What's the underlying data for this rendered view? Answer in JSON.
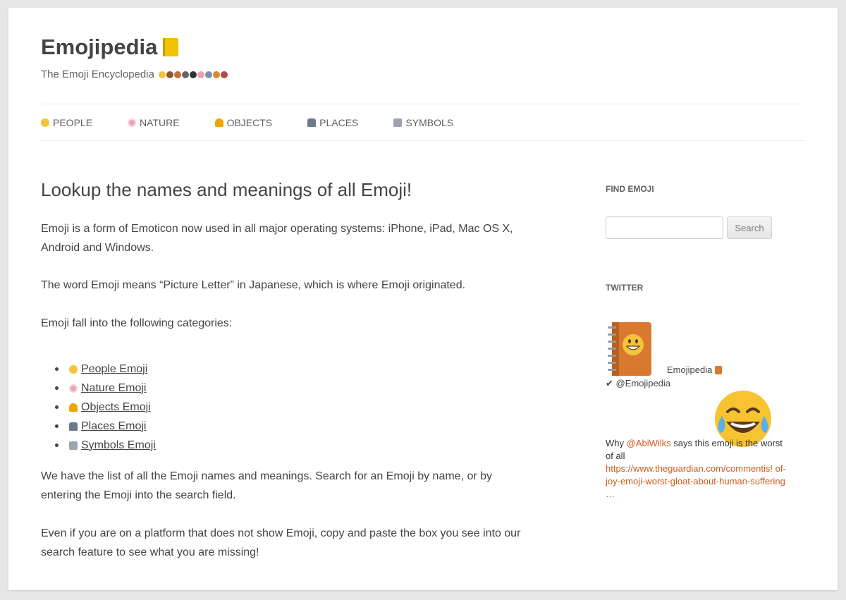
{
  "site": {
    "title": "Emojipedia",
    "title_icon": "notebook-icon",
    "tagline": "The Emoji Encyclopedia"
  },
  "nav": {
    "items": [
      {
        "label": "PEOPLE",
        "icon": "smiley-icon"
      },
      {
        "label": "NATURE",
        "icon": "flower-icon"
      },
      {
        "label": "OBJECTS",
        "icon": "bell-icon"
      },
      {
        "label": "PLACES",
        "icon": "car-icon"
      },
      {
        "label": "SYMBOLS",
        "icon": "symbols-icon"
      }
    ]
  },
  "main": {
    "heading": "Lookup the names and meanings of all Emoji!",
    "paragraphs": [
      "Emoji is a form of Emoticon now used in all major operating systems: iPhone, iPad, Mac OS X, Android and Windows.",
      "The word Emoji means “Picture Letter” in Japanese, which is where Emoji originated.",
      "Emoji fall into the following categories:",
      "We have the list of all the Emoji names and meanings. Search for an Emoji by name, or by entering the Emoji into the search field.",
      "Even if you are on a platform that does not show Emoji, copy and paste the box you see into our search feature to see what you are missing!"
    ],
    "categories": [
      {
        "label": "People Emoji",
        "icon": "smiley-icon"
      },
      {
        "label": "Nature Emoji",
        "icon": "flower-icon"
      },
      {
        "label": "Objects Emoji",
        "icon": "bell-icon"
      },
      {
        "label": "Places Emoji",
        "icon": "car-icon"
      },
      {
        "label": "Symbols Emoji",
        "icon": "symbols-icon"
      }
    ]
  },
  "sidebar": {
    "find_title": "FIND EMOJI",
    "search_value": "",
    "search_button": "Search",
    "twitter_title": "TWITTER",
    "tweet": {
      "name": "Emojipedia",
      "handle": "✔ @Emojipedia",
      "text_before": "Why ",
      "mention": "@AbiWilks",
      "text_after": " says this emoji is the worst of all",
      "link": "https://www.theguardian.com/commentisfree/2016/may/04/tears-of-joy-emoji-worst-gloat-about-human-suffering",
      "link_display": "https://www.theguardian.com/commentis! of-joy-emoji-worst-gloat-about-human-suffering …"
    }
  },
  "colors": {
    "link_orange": "#d05a1c",
    "text": "#444444",
    "background": "#e6e6e6"
  }
}
